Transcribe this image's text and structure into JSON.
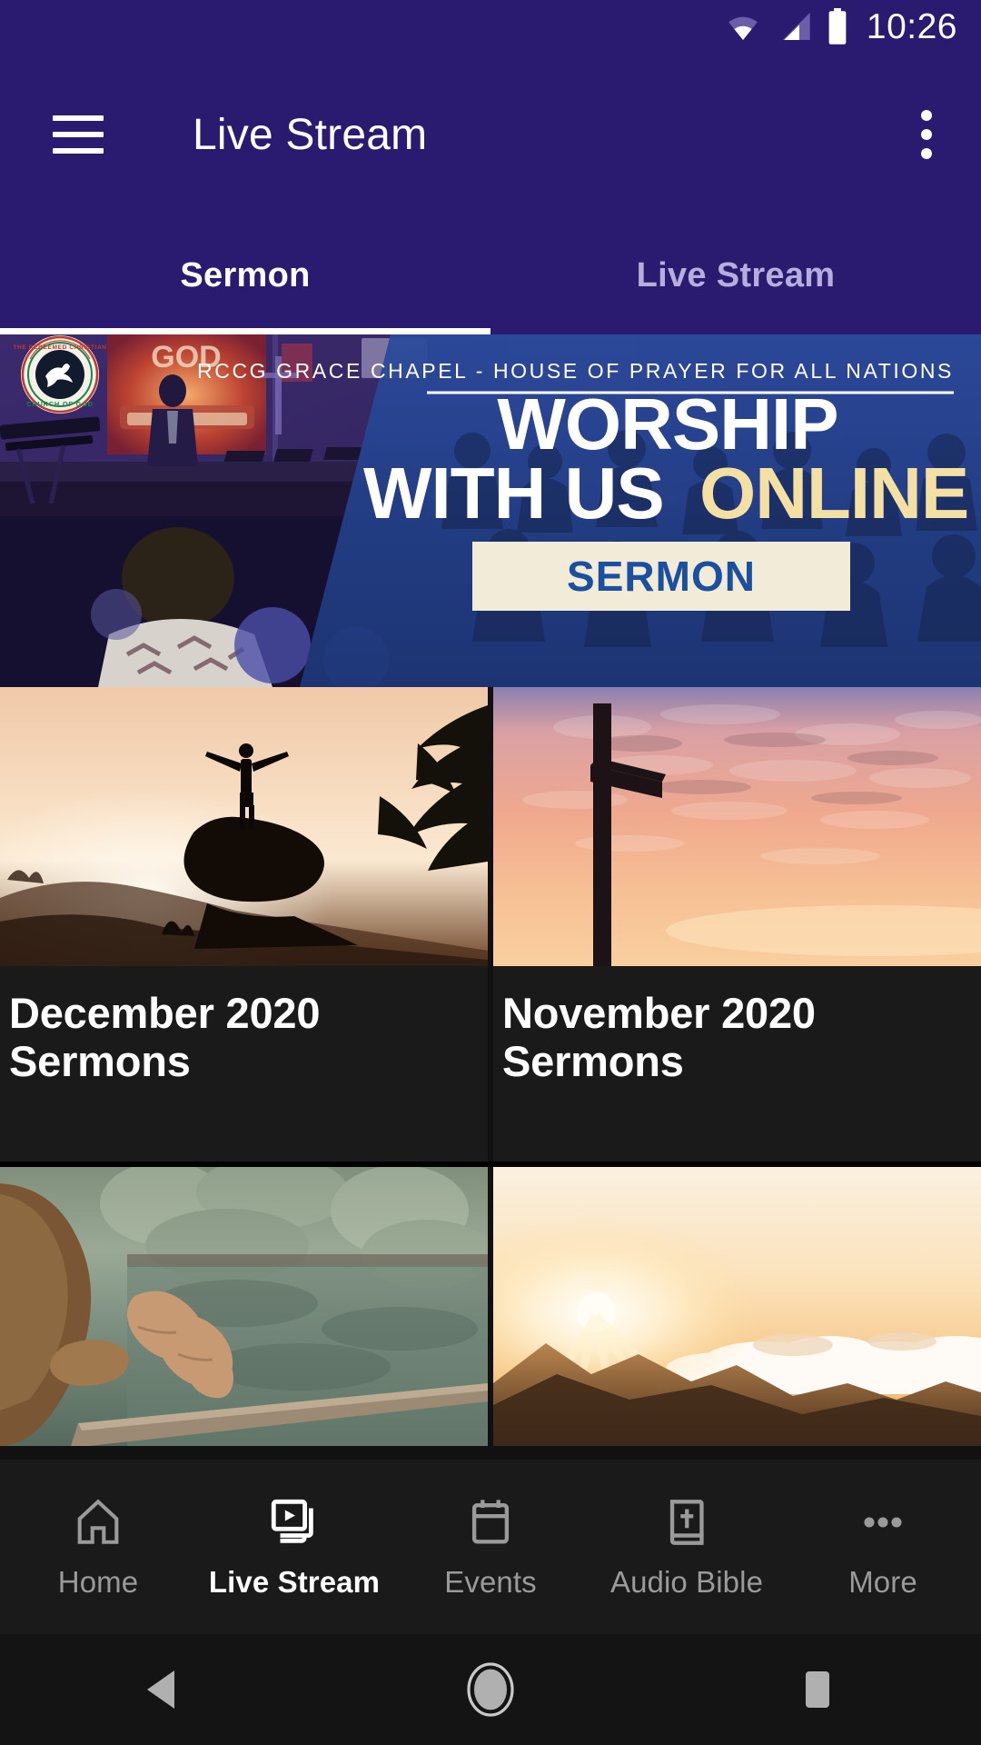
{
  "status_bar": {
    "time": "10:26",
    "icons": [
      "wifi-icon",
      "cellular-signal-icon",
      "battery-icon"
    ]
  },
  "app_bar": {
    "menu_icon": "hamburger-menu-icon",
    "title": "Live Stream",
    "overflow_icon": "more-vertical-icon"
  },
  "tabs": {
    "active_index": 0,
    "items": [
      {
        "label": "Sermon",
        "active": true
      },
      {
        "label": "Live Stream",
        "active": false
      }
    ]
  },
  "hero": {
    "logo_alt": "rccg-logo-icon",
    "logo_text_top": "THE REDEEMED CHRISTIAN",
    "logo_text_bottom": "CHURCH OF GOD",
    "eyebrow": "RCCG GRACE CHAPEL - HOUSE OF PRAYER FOR ALL NATIONS",
    "headline_line1": "WORSHIP",
    "headline_line2_white": "WITH US",
    "headline_line2_gold": "ONLINE",
    "badge": "SERMON",
    "colors": {
      "gold": "#F5E0A3",
      "badge_bg": "#F2EBD8",
      "badge_text": "#1B4FA0",
      "overlay": "#2B4C9B"
    },
    "backdrop_text": "GOD"
  },
  "sermon_cards": [
    {
      "title": "December 2020 Sermons",
      "image": "man-on-rock-sunset-silhouette"
    },
    {
      "title": "November 2020 Sermons",
      "image": "cross-silhouette-pink-sunset"
    },
    {
      "title": "",
      "image": "praying-hands-forest-lake"
    },
    {
      "title": "",
      "image": "sunrise-over-mountains-clouds"
    }
  ],
  "bottom_nav": {
    "active_index": 1,
    "items": [
      {
        "label": "Home",
        "icon": "home-icon",
        "active": false
      },
      {
        "label": "Live Stream",
        "icon": "video-library-icon",
        "active": true
      },
      {
        "label": "Events",
        "icon": "calendar-icon",
        "active": false
      },
      {
        "label": "Audio Bible",
        "icon": "bible-book-icon",
        "active": false
      },
      {
        "label": "More",
        "icon": "more-horizontal-icon",
        "active": false
      }
    ]
  },
  "system_nav": {
    "back": "back-triangle-icon",
    "home": "home-circle-icon",
    "recents": "recents-square-icon"
  },
  "theme": {
    "primary": "#2B1B70",
    "surface": "#1a1a1a",
    "background": "#111111",
    "on_primary": "#ffffff",
    "inactive": "#9a9a9a"
  }
}
